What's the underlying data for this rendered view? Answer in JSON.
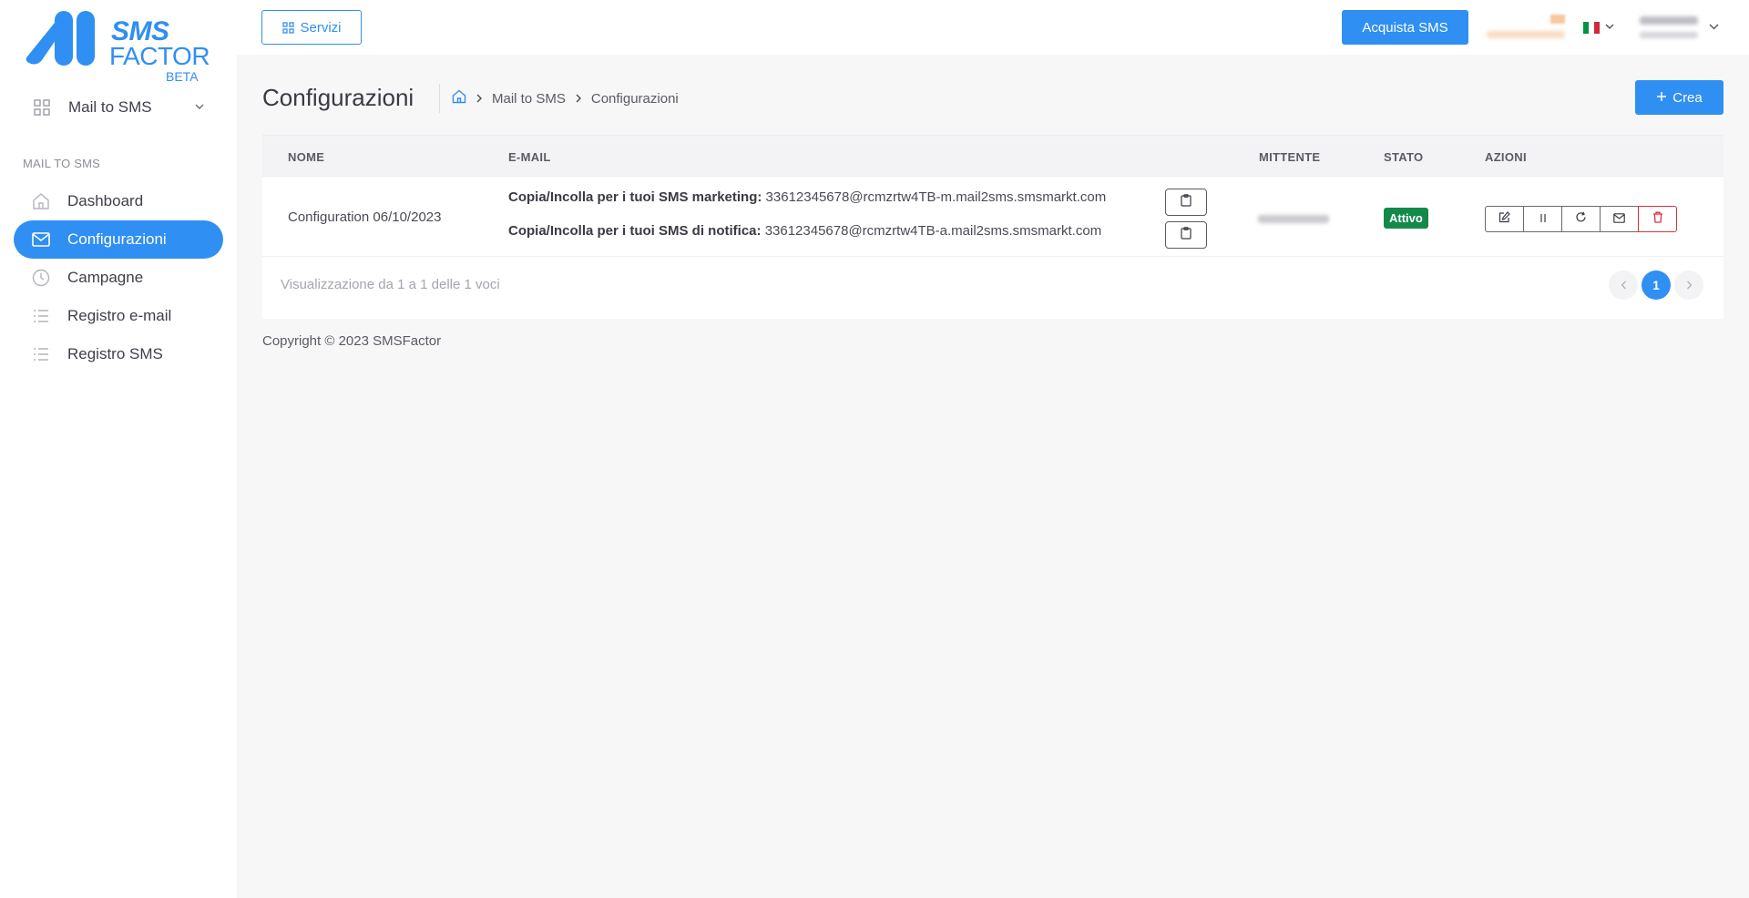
{
  "logo": {
    "line1": "SMS",
    "line2": "FACTOR",
    "line3": "BETA"
  },
  "sidebar": {
    "group": {
      "label": "Mail to SMS",
      "icon": "grid-icon"
    },
    "section_title": "MAIL TO SMS",
    "items": [
      {
        "label": "Dashboard",
        "icon": "home-icon"
      },
      {
        "label": "Configurazioni",
        "icon": "mail-icon",
        "active": true
      },
      {
        "label": "Campagne",
        "icon": "clock-icon"
      },
      {
        "label": "Registro e-mail",
        "icon": "list-icon"
      },
      {
        "label": "Registro SMS",
        "icon": "list-icon"
      }
    ]
  },
  "topbar": {
    "servizi_label": "Servizi",
    "acquista_label": "Acquista SMS",
    "language": "it"
  },
  "page": {
    "title": "Configurazioni",
    "breadcrumb": [
      "Mail to SMS",
      "Configurazioni"
    ],
    "crea_label": "Crea"
  },
  "table": {
    "headers": {
      "nome": "NOME",
      "email": "E-MAIL",
      "mittente": "MITTENTE",
      "stato": "STATO",
      "azioni": "AZIONI"
    },
    "rows": [
      {
        "nome": "Configuration 06/10/2023",
        "email_marketing_label": "Copia/Incolla per i tuoi SMS marketing:",
        "email_marketing": "33612345678@rcmzrtw4TB-m.mail2sms.smsmarkt.com",
        "email_notifica_label": "Copia/Incolla per i tuoi SMS di notifica:",
        "email_notifica": "33612345678@rcmzrtw4TB-a.mail2sms.smsmarkt.com",
        "stato": "Attivo"
      }
    ],
    "info": "Visualizzazione da 1 a 1 delle 1 voci",
    "current_page": "1"
  },
  "footer": {
    "copyright": "Copyright © 2023 SMSFactor"
  },
  "colors": {
    "primary": "#2f8ff2",
    "success": "#138a4a",
    "danger": "#d6333f"
  }
}
